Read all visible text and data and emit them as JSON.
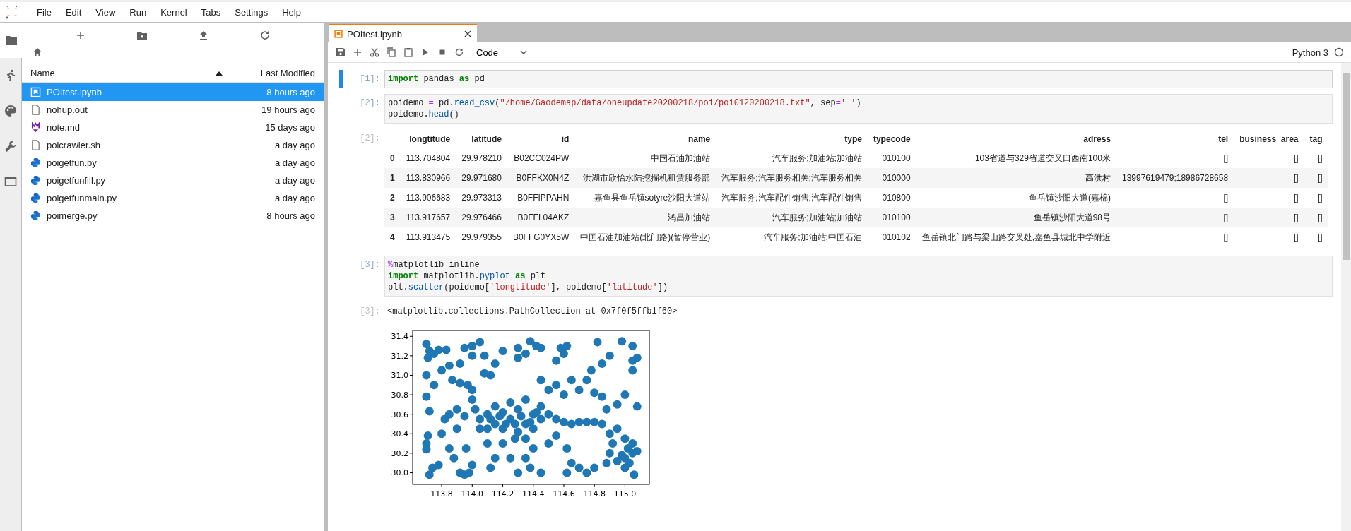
{
  "menu_bar": {
    "items": [
      "File",
      "Edit",
      "View",
      "Run",
      "Kernel",
      "Tabs",
      "Settings",
      "Help"
    ]
  },
  "left_sidebar": {
    "tabs": [
      {
        "kind": "folder",
        "selected": true
      },
      {
        "kind": "running",
        "selected": false
      },
      {
        "kind": "palette",
        "selected": false
      },
      {
        "kind": "wrench",
        "selected": false
      },
      {
        "kind": "tabs",
        "selected": false
      }
    ]
  },
  "file_browser": {
    "columns": [
      "Name",
      "Last Modified"
    ],
    "files": [
      {
        "kind": "notebook",
        "name": "POItest.ipynb",
        "modified": "8 hours ago",
        "selected": true
      },
      {
        "kind": "text",
        "name": "nohup.out",
        "modified": "19 hours ago",
        "selected": false
      },
      {
        "kind": "markdown",
        "name": "note.md",
        "modified": "15 days ago",
        "selected": false
      },
      {
        "kind": "text",
        "name": "poicrawler.sh",
        "modified": "a day ago",
        "selected": false
      },
      {
        "kind": "python",
        "name": "poigetfun.py",
        "modified": "a day ago",
        "selected": false
      },
      {
        "kind": "python",
        "name": "poigetfunfill.py",
        "modified": "a day ago",
        "selected": false
      },
      {
        "kind": "python",
        "name": "poigetfunmain.py",
        "modified": "a day ago",
        "selected": false
      },
      {
        "kind": "python",
        "name": "poimerge.py",
        "modified": "8 hours ago",
        "selected": false
      }
    ]
  },
  "notebook": {
    "tab_title": "POItest.ipynb",
    "cell_type": "Code",
    "kernel": "Python 3",
    "cells": [
      {
        "prompt": "[1]:",
        "active": true,
        "lines": [
          [
            {
              "kind": "keyword",
              "text": "import"
            },
            {
              "kind": "plain",
              "text": " pandas "
            },
            {
              "kind": "keyword",
              "text": "as"
            },
            {
              "kind": "plain",
              "text": " pd"
            }
          ]
        ]
      },
      {
        "prompt": "[2]:",
        "active": false,
        "lines": [
          [
            {
              "kind": "plain",
              "text": "poidemo "
            },
            {
              "kind": "operator",
              "text": "="
            },
            {
              "kind": "plain",
              "text": " pd."
            },
            {
              "kind": "attribute",
              "text": "read_csv"
            },
            {
              "kind": "plain",
              "text": "("
            },
            {
              "kind": "string",
              "text": "\"/home/Gaodemap/data/oneupdate20200218/poi/poi0120200218.txt\""
            },
            {
              "kind": "plain",
              "text": ", sep"
            },
            {
              "kind": "operator",
              "text": "="
            },
            {
              "kind": "string",
              "text": "' '"
            },
            {
              "kind": "plain",
              "text": ")"
            }
          ],
          [
            {
              "kind": "plain",
              "text": "poidemo."
            },
            {
              "kind": "attribute",
              "text": "head"
            },
            {
              "kind": "plain",
              "text": "()"
            }
          ]
        ],
        "output": {
          "prompt": "[2]:",
          "table": {
            "columns": [
              "longtitude",
              "latitude",
              "id",
              "name",
              "type",
              "typecode",
              "adress",
              "tel",
              "business_area",
              "tag"
            ],
            "rows": [
              {
                "index": "0",
                "cells": [
                  "113.704804",
                  "29.978210",
                  "B02CC024PW",
                  "中国石油加油站",
                  "汽车服务;加油站;加油站",
                  "010100",
                  "103省道与329省道交叉口西南100米",
                  "[]",
                  "[]",
                  "[]"
                ]
              },
              {
                "index": "1",
                "cells": [
                  "113.830966",
                  "29.971680",
                  "B0FFKX0N4Z",
                  "洪湖市欣怡水陆挖掘机租赁服务部",
                  "汽车服务;汽车服务相关;汽车服务相关",
                  "010000",
                  "高洪村",
                  "13997619479;18986728658",
                  "[]",
                  "[]"
                ]
              },
              {
                "index": "2",
                "cells": [
                  "113.906683",
                  "29.973313",
                  "B0FFIPPAHN",
                  "嘉鱼县鱼岳镇sotyre沙阳大道站",
                  "汽车服务;汽车配件销售;汽车配件销售",
                  "010800",
                  "鱼岳镇沙阳大道(嘉棉)",
                  "[]",
                  "[]",
                  "[]"
                ]
              },
              {
                "index": "3",
                "cells": [
                  "113.917657",
                  "29.976466",
                  "B0FFL04AKZ",
                  "鸿昌加油站",
                  "汽车服务;加油站;加油站",
                  "010100",
                  "鱼岳镇沙阳大道98号",
                  "[]",
                  "[]",
                  "[]"
                ]
              },
              {
                "index": "4",
                "cells": [
                  "113.913475",
                  "29.979355",
                  "B0FFG0YX5W",
                  "中国石油加油站(北门路)(暂停营业)",
                  "汽车服务;加油站;中国石油",
                  "010102",
                  "鱼岳镇北门路与梁山路交叉处,嘉鱼县城北中学附近",
                  "[]",
                  "[]",
                  "[]"
                ]
              }
            ]
          }
        }
      },
      {
        "prompt": "[3]:",
        "active": false,
        "lines": [
          [
            {
              "kind": "magic",
              "text": "%"
            },
            {
              "kind": "plain",
              "text": "matplotlib inline"
            }
          ],
          [
            {
              "kind": "keyword",
              "text": "import"
            },
            {
              "kind": "plain",
              "text": " matplotlib."
            },
            {
              "kind": "attribute",
              "text": "pyplot"
            },
            {
              "kind": "keyword",
              "text": " as"
            },
            {
              "kind": "plain",
              "text": " plt"
            }
          ],
          [
            {
              "kind": "plain",
              "text": "plt."
            },
            {
              "kind": "attribute",
              "text": "scatter"
            },
            {
              "kind": "plain",
              "text": "(poidemo["
            },
            {
              "kind": "string",
              "text": "'longtitude'"
            },
            {
              "kind": "plain",
              "text": "], poidemo["
            },
            {
              "kind": "string",
              "text": "'latitude'"
            },
            {
              "kind": "plain",
              "text": "])"
            }
          ]
        ],
        "output": {
          "prompt": "[3]:",
          "text": "<matplotlib.collections.PathCollection at 0x7f0f5ffb1f60>",
          "chart_data": {
            "type": "scatter",
            "xlim": [
              113.61,
              115.16
            ],
            "ylim": [
              29.88,
              31.46
            ],
            "xticks": [
              {
                "value": 113.8,
                "label": "113.8"
              },
              {
                "value": 114.0,
                "label": "114.0"
              },
              {
                "value": 114.2,
                "label": "114.2"
              },
              {
                "value": 114.4,
                "label": "114.4"
              },
              {
                "value": 114.6,
                "label": "114.6"
              },
              {
                "value": 114.8,
                "label": "114.8"
              },
              {
                "value": 115.0,
                "label": "115.0"
              }
            ],
            "yticks": [
              {
                "value": 30.0,
                "label": "30.0"
              },
              {
                "value": 30.2,
                "label": "30.2"
              },
              {
                "value": 30.4,
                "label": "30.4"
              },
              {
                "value": 30.6,
                "label": "30.6"
              },
              {
                "value": 30.8,
                "label": "30.8"
              },
              {
                "value": 31.0,
                "label": "31.0"
              },
              {
                "value": 31.2,
                "label": "31.2"
              },
              {
                "value": 31.4,
                "label": "31.4"
              }
            ],
            "x": [
              113.7,
              113.72,
              113.75,
              113.78,
              113.71,
              113.83,
              113.7,
              113.75,
              113.8,
              113.85,
              113.87,
              113.92,
              113.97,
              114.0,
              114.0,
              114.02,
              113.7,
              113.72,
              113.71,
              113.7,
              113.7,
              113.74,
              113.72,
              113.78,
              113.8,
              113.82,
              113.85,
              113.9,
              113.95,
              113.9,
              113.85,
              113.88,
              113.92,
              113.95,
              113.98,
              114.0,
              113.96,
              113.95,
              114.0,
              114.05,
              114.08,
              114.0,
              113.92,
              114.08,
              114.12,
              114.15,
              114.2,
              114.3,
              114.3,
              114.38,
              114.35,
              114.42,
              114.45,
              114.58,
              114.62,
              114.6,
              114.55,
              114.05,
              114.1,
              114.15,
              114.2,
              114.25,
              114.3,
              114.35,
              114.4,
              114.45,
              114.5,
              114.1,
              114.2,
              114.3,
              114.4,
              114.25,
              114.35,
              114.15,
              114.45,
              114.05,
              114.28,
              114.35,
              114.12,
              114.18,
              114.22,
              114.32,
              114.38,
              114.42,
              114.28,
              114.55,
              114.6,
              114.65,
              114.7,
              114.75,
              114.8,
              114.85,
              114.9,
              114.95,
              115.0,
              114.92,
              115.05,
              115.0,
              114.95,
              115.08,
              114.9,
              115.03,
              114.88,
              115.05,
              115.06,
              114.98,
              115.02,
              115.0,
              115.05,
              115.08,
              115.05,
              114.98,
              114.9,
              114.85,
              114.82,
              115.05,
              114.78,
              114.75,
              114.8,
              114.85,
              114.88,
              114.95,
              115.08,
              115.0,
              114.6,
              114.55,
              114.65,
              114.5,
              114.45,
              114.7,
              114.62,
              114.65,
              114.7,
              114.62,
              114.75,
              114.8,
              114.45,
              114.38,
              114.3,
              114.25,
              114.15,
              114.12,
              114.2,
              114.1,
              114.55,
              114.5,
              114.4,
              114.35
            ],
            "series": [
              {
                "color": "#1f77b4",
                "values": [
                  31.32,
                  31.25,
                  31.22,
                  31.26,
                  31.18,
                  31.26,
                  31.0,
                  30.9,
                  31.05,
                  31.1,
                  30.95,
                  30.92,
                  30.9,
                  30.85,
                  30.75,
                  30.65,
                  30.78,
                  30.63,
                  30.38,
                  30.3,
                  30.24,
                  30.05,
                  29.98,
                  30.08,
                  30.4,
                  30.55,
                  30.6,
                  30.65,
                  30.58,
                  30.45,
                  30.25,
                  30.15,
                  30.0,
                  29.98,
                  30.0,
                  30.08,
                  30.25,
                  31.28,
                  31.3,
                  31.34,
                  31.2,
                  31.2,
                  31.12,
                  31.02,
                  31.0,
                  31.12,
                  31.25,
                  31.28,
                  31.18,
                  31.35,
                  31.22,
                  31.3,
                  31.28,
                  31.28,
                  31.3,
                  31.22,
                  31.15,
                  30.55,
                  30.6,
                  30.5,
                  30.62,
                  30.55,
                  30.65,
                  30.5,
                  30.6,
                  30.55,
                  30.6,
                  30.45,
                  30.45,
                  30.42,
                  30.45,
                  30.72,
                  30.75,
                  30.68,
                  30.68,
                  30.45,
                  30.35,
                  30.35,
                  30.55,
                  30.58,
                  30.5,
                  30.58,
                  30.52,
                  30.62,
                  30.5,
                  30.55,
                  30.52,
                  30.5,
                  30.52,
                  30.52,
                  30.52,
                  30.5,
                  30.4,
                  30.45,
                  30.35,
                  30.3,
                  30.2,
                  30.15,
                  30.12,
                  30.22,
                  30.2,
                  30.1,
                  30.1,
                  30.3,
                  29.98,
                  30.18,
                  30.25,
                  30.05,
                  31.15,
                  31.18,
                  31.3,
                  31.35,
                  31.2,
                  31.12,
                  31.34,
                  31.05,
                  31.05,
                  30.95,
                  30.82,
                  30.78,
                  30.65,
                  30.7,
                  30.68,
                  30.8,
                  30.8,
                  30.9,
                  30.95,
                  30.85,
                  30.95,
                  30.85,
                  30.25,
                  30.1,
                  30.05,
                  30.0,
                  30.0,
                  30.05,
                  30.0,
                  30.05,
                  30.0,
                  30.15,
                  30.15,
                  30.05,
                  30.3,
                  30.3,
                  30.38,
                  30.3,
                  30.25,
                  30.15
                ]
              }
            ]
          }
        }
      }
    ]
  }
}
